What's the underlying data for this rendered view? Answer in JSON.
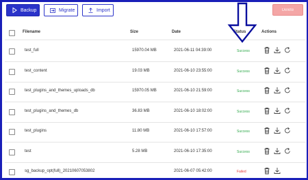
{
  "toolbar": {
    "backup_label": "Backup",
    "migrate_label": "Migrate",
    "import_label": "Import",
    "delete_label": "Delete"
  },
  "table": {
    "headers": {
      "filename": "Filename",
      "size": "Size",
      "date": "Date",
      "status": "Status",
      "actions": "Actions"
    },
    "rows": [
      {
        "filename": "test_full",
        "size": "15970.04 MB",
        "date": "2021-06-11 04:39:00",
        "status": "Success"
      },
      {
        "filename": "test_content",
        "size": "19.03 MB",
        "date": "2021-06-10 23:55:00",
        "status": "Success"
      },
      {
        "filename": "test_plugins_and_themes_uploads_db",
        "size": "15970.05 MB",
        "date": "2021-06-10 21:59:00",
        "status": "Success"
      },
      {
        "filename": "test_plugins_and_themes_db",
        "size": "36.83 MB",
        "date": "2021-06-10 18:02:00",
        "status": "Success"
      },
      {
        "filename": "test_plugins",
        "size": "11.80 MB",
        "date": "2021-06-10 17:57:00",
        "status": "Success"
      },
      {
        "filename": "test",
        "size": "5.28 MB",
        "date": "2021-06-10 17:35:00",
        "status": "Success"
      },
      {
        "filename": "sg_backup_opt(full)_20210607053802",
        "size": "",
        "date": "2021-06-07 05:42:00",
        "status": "Failed"
      }
    ]
  },
  "colors": {
    "accent": "#2a33c9",
    "success": "#2ea84a",
    "failed": "#e23a3a",
    "delete_disabled": "#f4a6a6",
    "frame": "#1a1fb8"
  }
}
